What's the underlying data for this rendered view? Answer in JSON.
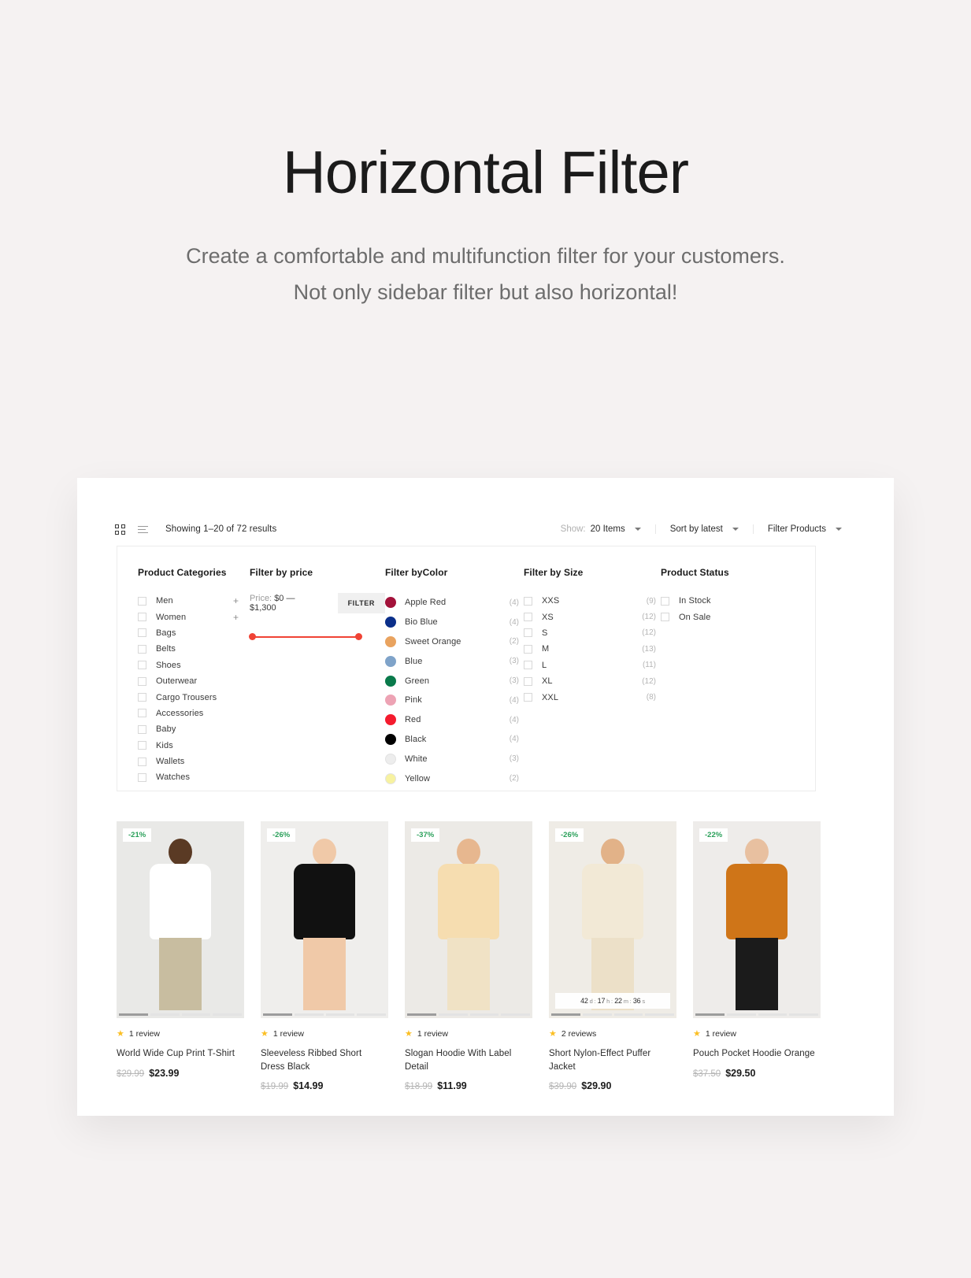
{
  "hero": {
    "title": "Horizontal Filter",
    "subtitle_line1": "Create a comfortable and multifunction filter for your customers.",
    "subtitle_line2": "Not only sidebar filter but also horizontal!"
  },
  "toolbar": {
    "grid_view_icon": "grid-view-icon",
    "list_view_icon": "list-view-icon",
    "results": "Showing 1–20 of 72 results",
    "show_label": "Show:",
    "show_value": "20 Items",
    "sort_value": "Sort by latest",
    "filter_products": "Filter Products"
  },
  "filters": {
    "categories": {
      "title": "Product Categories",
      "items": [
        {
          "label": "Men",
          "expand": "+"
        },
        {
          "label": "Women",
          "expand": "+"
        },
        {
          "label": "Bags",
          "expand": ""
        },
        {
          "label": "Belts",
          "expand": ""
        },
        {
          "label": "Shoes",
          "expand": ""
        },
        {
          "label": "Outerwear",
          "expand": ""
        },
        {
          "label": "Cargo Trousers",
          "expand": ""
        },
        {
          "label": "Accessories",
          "expand": ""
        },
        {
          "label": "Baby",
          "expand": ""
        },
        {
          "label": "Kids",
          "expand": ""
        },
        {
          "label": "Wallets",
          "expand": ""
        },
        {
          "label": "Watches",
          "expand": ""
        }
      ]
    },
    "price": {
      "title": "Filter by price",
      "prefix": "Price:",
      "range": "$0 — $1,300",
      "button": "FILTER",
      "min": 0,
      "max": 1300,
      "accent": "#f04335"
    },
    "color": {
      "title": "Filter byColor",
      "items": [
        {
          "label": "Apple Red",
          "count": "(4)",
          "hex": "#a3123a"
        },
        {
          "label": "Bio Blue",
          "count": "(4)",
          "hex": "#0b2f8a"
        },
        {
          "label": "Sweet Orange",
          "count": "(2)",
          "hex": "#e9a35f"
        },
        {
          "label": "Blue",
          "count": "(3)",
          "hex": "#7fa3c9"
        },
        {
          "label": "Green",
          "count": "(3)",
          "hex": "#0a7a4b"
        },
        {
          "label": "Pink",
          "count": "(4)",
          "hex": "#eda3b4"
        },
        {
          "label": "Red",
          "count": "(4)",
          "hex": "#f41b2e"
        },
        {
          "label": "Black",
          "count": "(4)",
          "hex": "#000000"
        },
        {
          "label": "White",
          "count": "(3)",
          "hex": "#ededed"
        },
        {
          "label": "Yellow",
          "count": "(2)",
          "hex": "#f7f2a0"
        }
      ]
    },
    "size": {
      "title": "Filter by Size",
      "items": [
        {
          "label": "XXS",
          "count": "(9)"
        },
        {
          "label": "XS",
          "count": "(12)"
        },
        {
          "label": "S",
          "count": "(12)"
        },
        {
          "label": "M",
          "count": "(13)"
        },
        {
          "label": "L",
          "count": "(11)"
        },
        {
          "label": "XL",
          "count": "(12)"
        },
        {
          "label": "XXL",
          "count": "(8)"
        }
      ]
    },
    "status": {
      "title": "Product Status",
      "items": [
        {
          "label": "In Stock"
        },
        {
          "label": "On Sale"
        }
      ]
    }
  },
  "products": [
    {
      "badge": "-21%",
      "reviews": "1 review",
      "title": "World Wide Cup Print T-Shirt",
      "old_price": "$29.99",
      "new_price": "$23.99",
      "countdown": null
    },
    {
      "badge": "-26%",
      "reviews": "1 review",
      "title": "Sleeveless Ribbed Short Dress Black",
      "old_price": "$19.99",
      "new_price": "$14.99",
      "countdown": null
    },
    {
      "badge": "-37%",
      "reviews": "1 review",
      "title": "Slogan Hoodie With Label Detail",
      "old_price": "$18.99",
      "new_price": "$11.99",
      "countdown": null
    },
    {
      "badge": "-26%",
      "reviews": "2 reviews",
      "title": "Short Nylon-Effect Puffer Jacket",
      "old_price": "$39.90",
      "new_price": "$29.90",
      "countdown": {
        "d": "42",
        "d_u": "d",
        "h": "17",
        "h_u": "h",
        "m": "22",
        "m_u": "m",
        "s": "36",
        "s_u": "s",
        "sep": ":"
      }
    },
    {
      "badge": "-22%",
      "reviews": "1 review",
      "title": "Pouch Pocket Hoodie Orange",
      "old_price": "$37.50",
      "new_price": "$29.50",
      "countdown": null
    }
  ]
}
